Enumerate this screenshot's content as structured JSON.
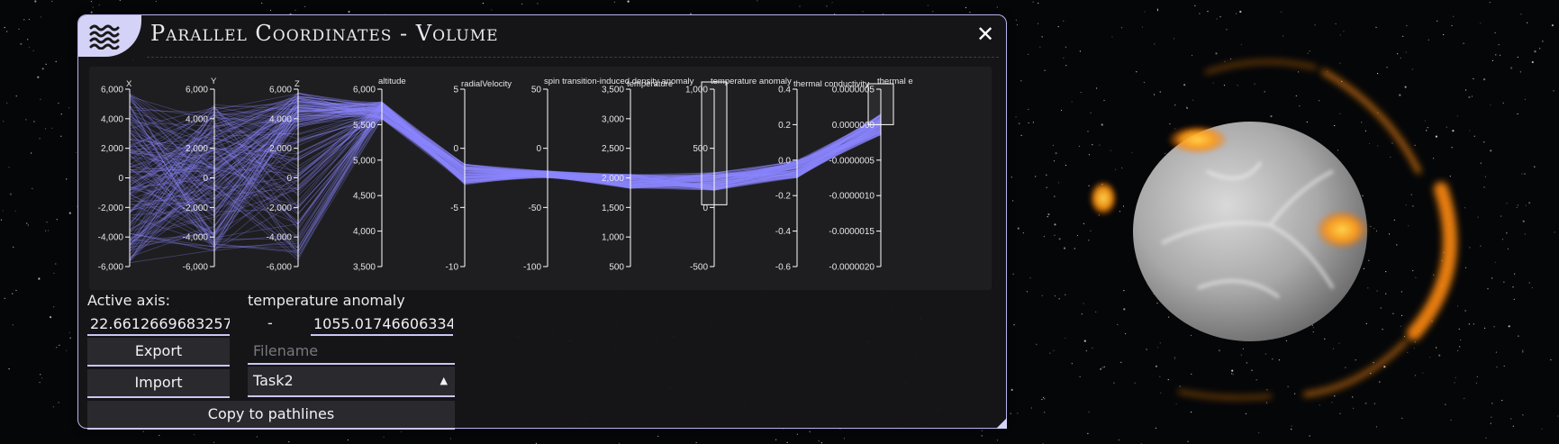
{
  "window": {
    "title": "Parallel Coordinates - Volume",
    "menu_icon": "waves-icon",
    "close_icon": "close-icon",
    "close_symbol": "✕"
  },
  "controls": {
    "active_axis_label": "Active axis:",
    "active_axis_name": "temperature anomaly",
    "range_min": "22.6612669683257",
    "range_separator": "-",
    "range_max": "1055.01746606334",
    "export_label": "Export",
    "import_label": "Import",
    "filename_placeholder": "Filename",
    "preset_selected": "Task2",
    "copy_label": "Copy to pathlines"
  },
  "colors": {
    "accent": "#c9c6f2",
    "line": "#8c87ff",
    "axis": "#ffffff",
    "panel_bg": "#161618",
    "plot_bg": "#1e1e20"
  },
  "chart_data": {
    "type": "parallel_coordinates",
    "axes": [
      {
        "name": "X",
        "ticks": [
          "6,000",
          "4,000",
          "2,000",
          "0",
          "-2,000",
          "-4,000",
          "-6,000"
        ]
      },
      {
        "name": "Y",
        "ticks": [
          "6,000",
          "4,000",
          "2,000",
          "0",
          "-2,000",
          "-4,000",
          "-6,000"
        ]
      },
      {
        "name": "Z",
        "ticks": [
          "6,000",
          "4,000",
          "2,000",
          "0",
          "-2,000",
          "-4,000",
          "-6,000"
        ]
      },
      {
        "name": "altitude",
        "ticks": [
          "6,000",
          "5,500",
          "5,000",
          "4,500",
          "4,000",
          "3,500"
        ]
      },
      {
        "name": "radialVelocity",
        "ticks": [
          "5",
          "0",
          "-5",
          "-10"
        ]
      },
      {
        "name": "spin transition-induced density anomaly",
        "ticks": [
          "50",
          "0",
          "-50",
          "-100"
        ]
      },
      {
        "name": "temperature",
        "ticks": [
          "3,500",
          "3,000",
          "2,500",
          "2,000",
          "1,500",
          "1,000",
          "500"
        ]
      },
      {
        "name": "temperature anomaly",
        "ticks": [
          "1,000",
          "500",
          "0",
          "-500"
        ],
        "brush": [
          22.66,
          1055.02
        ]
      },
      {
        "name": "thermal conductivity",
        "ticks": [
          "0.4",
          "0.2",
          "0.0",
          "-0.2",
          "-0.4",
          "-0.6"
        ]
      },
      {
        "name": "thermal e",
        "ticks": [
          "0.0000005",
          "0.0000000",
          "-0.0000005",
          "-0.0000010",
          "-0.0000015",
          "-0.0000020"
        ],
        "brush": [
          0.0,
          5e-07
        ]
      }
    ]
  }
}
